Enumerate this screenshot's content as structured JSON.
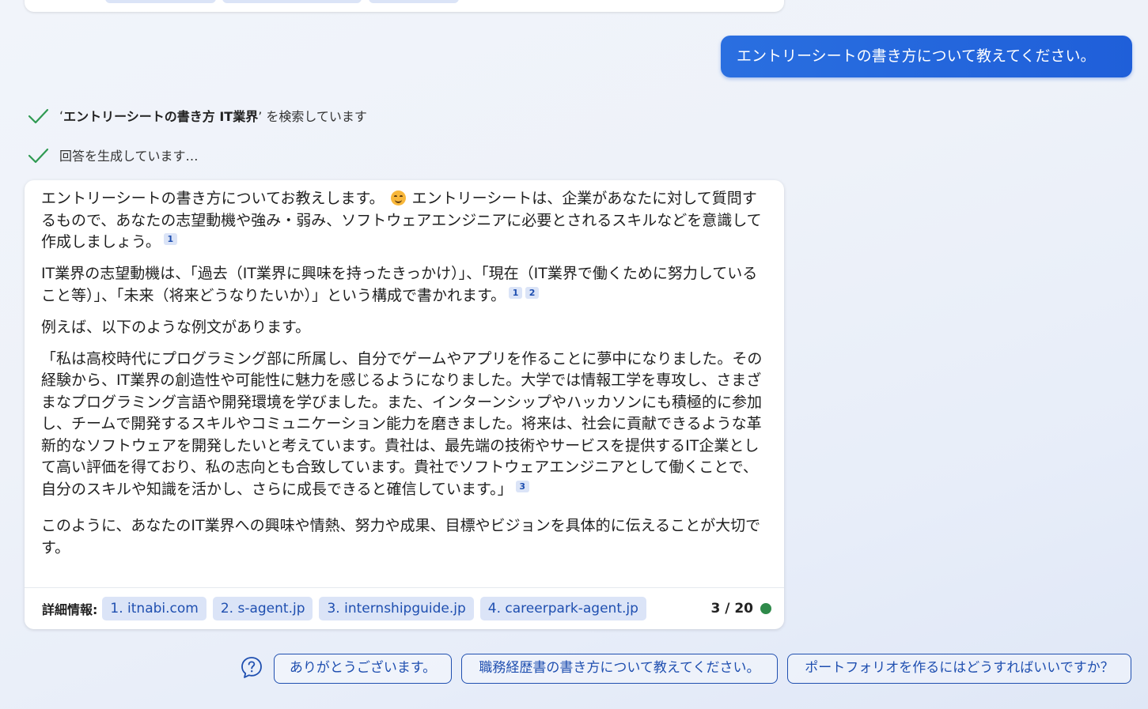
{
  "conversation": {
    "user_message": "エントリーシートの書き方について教えてください。",
    "status": {
      "search_prefix": "‘",
      "search_query": "エントリーシートの書き方 IT業界",
      "search_suffix": "’ を検索しています",
      "generating": "回答を生成しています…"
    },
    "answer": {
      "p1_a": "エントリーシートの書き方についてお教えします。",
      "p1_b": " エントリーシートは、企業があなたに対して質問するもので、あなたの志望動機や強み・弱み、ソフトウェアエンジニアに必要とされるスキルなどを意識して作成しましょう。",
      "p1_refs": [
        "1"
      ],
      "p2": "IT業界の志望動機は、「過去（IT業界に興味を持ったきっかけ）」、「現在（IT業界で働くために努力していること等）」、「未来（将来どうなりたいか）」という構成で書かれます。",
      "p2_refs": [
        "1",
        "2"
      ],
      "p3": "例えば、以下のような例文があります。",
      "p4": "「私は高校時代にプログラミング部に所属し、自分でゲームやアプリを作ることに夢中になりました。その経験から、IT業界の創造性や可能性に魅力を感じるようになりました。大学では情報工学を専攻し、さまざまなプログラミング言語や開発環境を学びました。また、インターンシップやハッカソンにも積極的に参加し、チームで開発するスキルやコミュニケーション能力を磨きました。将来は、社会に貢献できるような革新的なソフトウェアを開発したいと考えています。貴社は、最先端の技術やサービスを提供するIT企業として高い評価を得ており、私の志向とも合致しています。貴社でソフトウェアエンジニアとして働くことで、自分のスキルや知識を活かし、さらに成長できると確信しています。」",
      "p4_refs": [
        "3"
      ],
      "p5": "このように、あなたのIT業界への興味や情熱、努力や成果、目標やビジョンを具体的に伝えることが大切です。",
      "emoji": "smiling-face-icon"
    },
    "footer": {
      "label": "詳細情報:",
      "references": [
        "1. itnabi.com",
        "2. s-agent.jp",
        "3. internshipguide.jp",
        "4. careerpark-agent.jp"
      ],
      "count": "3 / 20",
      "status_color": "#2f8a4a"
    }
  },
  "suggestions": [
    "ありがとうございます。",
    "職務経歴書の書き方について教えてください。",
    "ポートフォリオを作るにはどうすればいいですか？"
  ],
  "colors": {
    "accent": "#1f5fd9",
    "link": "#1f4fb0",
    "chip_bg": "#dbe4f7",
    "check": "#2f9a52"
  }
}
